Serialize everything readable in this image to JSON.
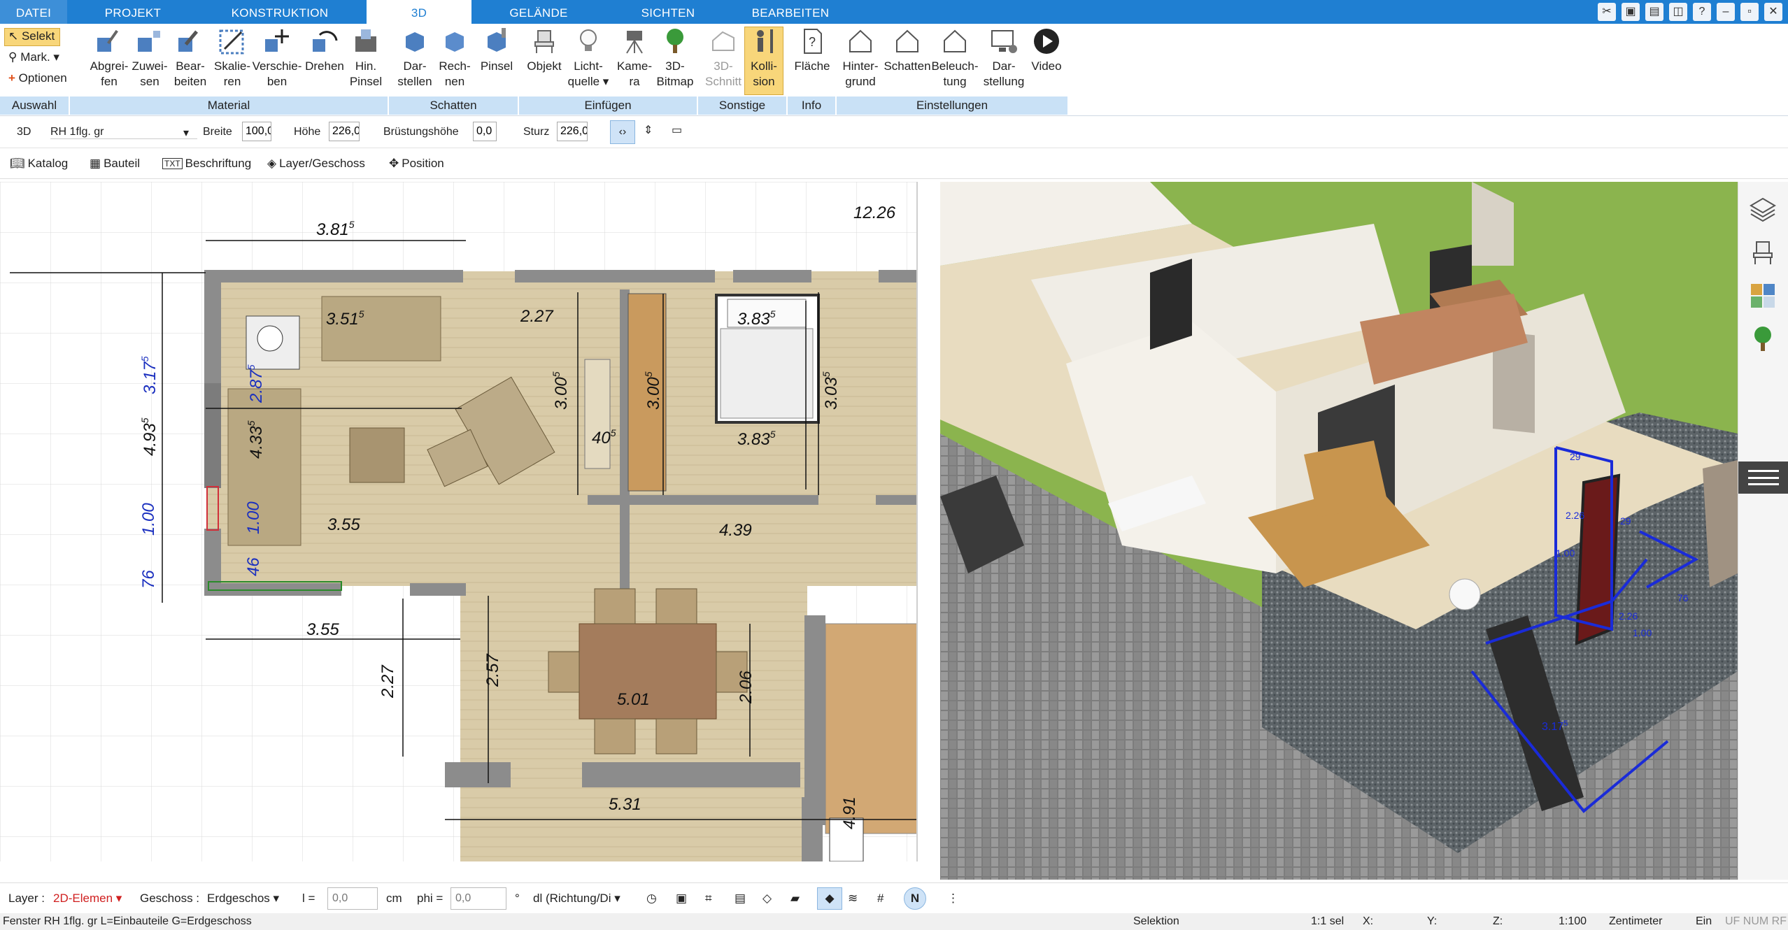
{
  "tabs": [
    "DATEI",
    "PROJEKT",
    "KONSTRUKTION",
    "3D",
    "GELÄNDE",
    "SICHTEN",
    "BEARBEITEN"
  ],
  "ribbon": {
    "auswahl": {
      "selekt": "Selekt",
      "mark": "Mark.",
      "optionen": "Optionen"
    },
    "material_buttons": [
      {
        "l1": "Abgrei-",
        "l2": "fen"
      },
      {
        "l1": "Zuwei-",
        "l2": "sen"
      },
      {
        "l1": "Bear-",
        "l2": "beiten"
      },
      {
        "l1": "Skalie-",
        "l2": "ren"
      },
      {
        "l1": "Verschie-",
        "l2": "ben"
      },
      {
        "l1": "Drehen",
        "l2": ""
      },
      {
        "l1": "Hin.",
        "l2": "Pinsel"
      }
    ],
    "schatten_buttons": [
      {
        "l1": "Dar-",
        "l2": "stellen"
      },
      {
        "l1": "Rech-",
        "l2": "nen"
      },
      {
        "l1": "Pinsel",
        "l2": ""
      }
    ],
    "einfuegen_buttons": [
      {
        "l1": "Objekt",
        "l2": ""
      },
      {
        "l1": "Licht-",
        "l2": "quelle"
      },
      {
        "l1": "Kame-",
        "l2": "ra"
      },
      {
        "l1": "3D-",
        "l2": "Bitmap"
      }
    ],
    "sonstige_buttons": [
      {
        "l1": "3D-",
        "l2": "Schnitt"
      },
      {
        "l1": "Kolli-",
        "l2": "sion"
      }
    ],
    "info_buttons": [
      {
        "l1": "Fläche",
        "l2": ""
      }
    ],
    "einstellungen_buttons": [
      {
        "l1": "Hinter-",
        "l2": "grund"
      },
      {
        "l1": "Schatten",
        "l2": ""
      },
      {
        "l1": "Beleuch-",
        "l2": "tung"
      },
      {
        "l1": "Dar-",
        "l2": "stellung"
      },
      {
        "l1": "Video",
        "l2": ""
      }
    ],
    "groups": [
      "Auswahl",
      "Material",
      "Schatten",
      "Einfügen",
      "Sonstige",
      "Info",
      "Einstellungen"
    ]
  },
  "props": {
    "mode": "3D",
    "object": "RH 1flg. gr",
    "breite_label": "Breite",
    "breite": "100,0",
    "hoehe_label": "Höhe",
    "hoehe": "226,0",
    "bruest_label": "Brüstungshöhe",
    "bruest": "0,0",
    "sturz_label": "Sturz",
    "sturz": "226,0"
  },
  "subtoolbar": [
    "Katalog",
    "Bauteil",
    "Beschriftung",
    "Layer/Geschoss",
    "Position"
  ],
  "plan_dims": {
    "d1": "3.81",
    "d1s": "5",
    "d2": "12.26",
    "d3": "3.51",
    "d3s": "5",
    "d4": "2.27",
    "d5": "3.83",
    "d5s": "5",
    "d6": "3.00",
    "d6s": "5",
    "d7": "3.00",
    "d7s": "5",
    "d8": "3.03",
    "d8s": "5",
    "d9": "3.83",
    "d9s": "5",
    "d10": "40",
    "d10s": "5",
    "d11": "3.55",
    "d12": "4.39",
    "d13": "3.55",
    "d14": "2.27",
    "d15": "2.57",
    "d16": "5.01",
    "d17": "2.06",
    "d18": "5.31",
    "d19": "4.91",
    "v1": "4.93",
    "v1s": "5",
    "v2": "1.00",
    "v3": "76",
    "b1": "3.17",
    "b1s": "5",
    "b2": "2.87",
    "b2s": "5",
    "b3": "4.33",
    "b3s": "5",
    "b4": "1.00",
    "b5": "46"
  },
  "view3d_labels": {
    "a": "29",
    "b": "2.26",
    "c": "1.00",
    "d": "76",
    "e": "2.26",
    "f": "1.00",
    "g": "3.17",
    "gs": "5",
    "h": "29"
  },
  "bottombar": {
    "layer_label": "Layer :",
    "layer_value": "2D-Elemen",
    "geschoss_label": "Geschoss :",
    "geschoss_value": "Erdgeschos",
    "l_label": "l =",
    "l_value": "0,0",
    "l_unit": "cm",
    "phi_label": "phi =",
    "phi_value": "0,0",
    "phi_unit": "°",
    "dl_value": "dl (Richtung/Di"
  },
  "status": {
    "left": "Fenster RH 1flg. gr L=Einbauteile G=Erdgeschoss",
    "mode": "Selektion",
    "sel": "1:1 sel",
    "x": "X:",
    "y": "Y:",
    "z": "Z:",
    "scale": "1:100",
    "unit": "Zentimeter",
    "ein": "Ein",
    "flags": "UF NUM RF"
  },
  "colors": {
    "tabbar": "#1f7fd2",
    "group": "#c9e1f6",
    "highlight": "#f8d67a",
    "grass": "#8bb44e",
    "floor": "#d8c8a6",
    "wall": "#8c8c8c"
  }
}
